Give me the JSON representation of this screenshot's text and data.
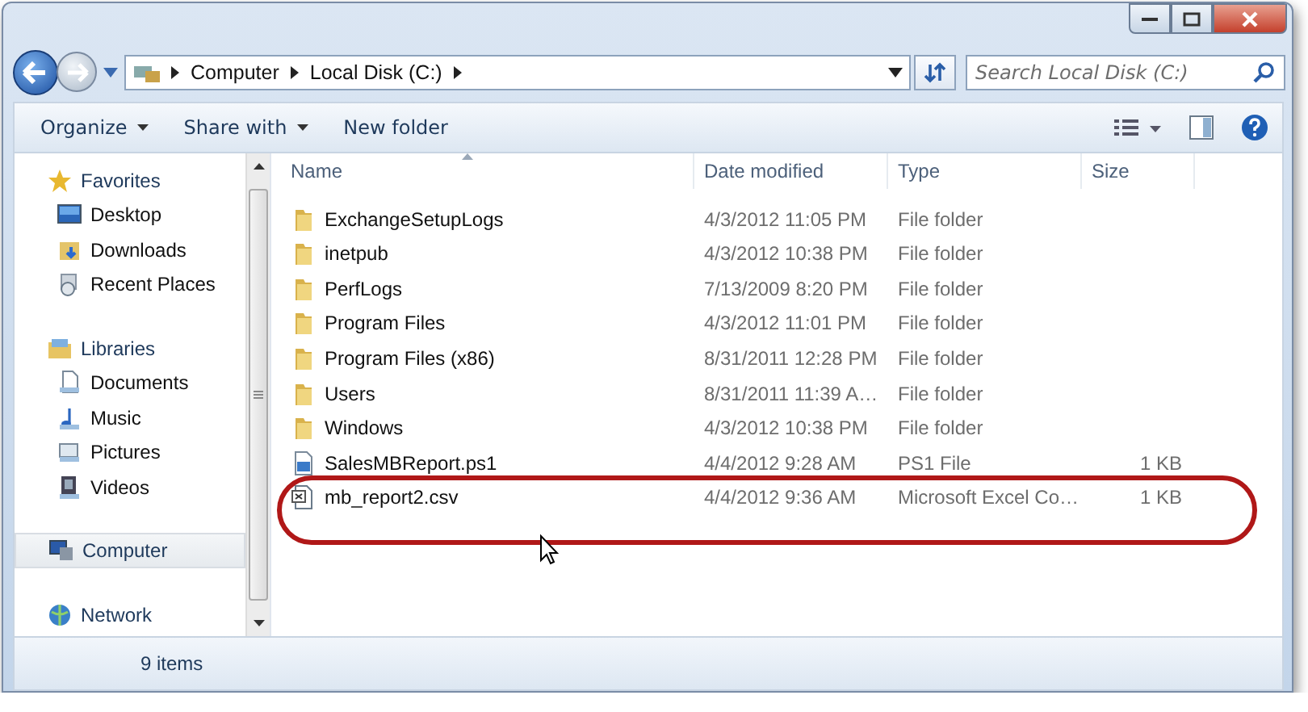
{
  "address": {
    "crumbs": [
      "Computer",
      "Local Disk (C:)"
    ]
  },
  "search": {
    "placeholder": "Search Local Disk (C:)"
  },
  "toolbar": [
    {
      "label": "Organize",
      "dropdown": true
    },
    {
      "label": "Share with",
      "dropdown": true
    },
    {
      "label": "New folder",
      "dropdown": false
    }
  ],
  "nav": [
    {
      "label": "Favorites",
      "selected": false,
      "children": [
        {
          "label": "Desktop",
          "selected": false
        },
        {
          "label": "Downloads",
          "selected": false
        },
        {
          "label": "Recent Places",
          "selected": false
        }
      ]
    },
    {
      "label": "Libraries",
      "selected": false,
      "children": [
        {
          "label": "Documents",
          "selected": false
        },
        {
          "label": "Music",
          "selected": false
        },
        {
          "label": "Pictures",
          "selected": false
        },
        {
          "label": "Videos",
          "selected": false
        }
      ]
    },
    {
      "label": "Computer",
      "selected": true
    },
    {
      "label": "Network",
      "selected": false
    }
  ],
  "columns": [
    {
      "label": "Name",
      "sorted": true
    },
    {
      "label": "Date modified",
      "sorted": false
    },
    {
      "label": "Type",
      "sorted": false
    },
    {
      "label": "Size",
      "sorted": false
    }
  ],
  "rows": [
    {
      "kind": "folder",
      "name": "ExchangeSetupLogs",
      "date": "4/3/2012 11:05 PM",
      "type": "File folder",
      "annotated": false
    },
    {
      "kind": "folder",
      "name": "inetpub",
      "date": "4/3/2012 10:38 PM",
      "type": "File folder",
      "annotated": false
    },
    {
      "kind": "folder",
      "name": "PerfLogs",
      "date": "7/13/2009 8:20 PM",
      "type": "File folder",
      "annotated": false
    },
    {
      "kind": "folder",
      "name": "Program Files",
      "date": "4/3/2012 11:01 PM",
      "type": "File folder",
      "annotated": false
    },
    {
      "kind": "folder",
      "name": "Program Files (x86)",
      "date": "8/31/2011 12:28 PM",
      "type": "File folder",
      "annotated": false
    },
    {
      "kind": "folder",
      "name": "Users",
      "date": "8/31/2011 11:39 A…",
      "type": "File folder",
      "annotated": false
    },
    {
      "kind": "folder",
      "name": "Windows",
      "date": "4/3/2012 10:38 PM",
      "type": "File folder",
      "annotated": false
    },
    {
      "kind": "script",
      "name": "SalesMBReport.ps1",
      "date": "4/4/2012 9:28 AM",
      "type": "PS1 File",
      "size": "1 KB",
      "annotated": false
    },
    {
      "kind": "spreadsheet",
      "name": "mb_report2.csv",
      "date": "4/4/2012 9:36 AM",
      "type": "Microsoft Excel Co…",
      "size": "1 KB",
      "annotated": true
    }
  ],
  "status_bar": {
    "count": "9 items"
  }
}
